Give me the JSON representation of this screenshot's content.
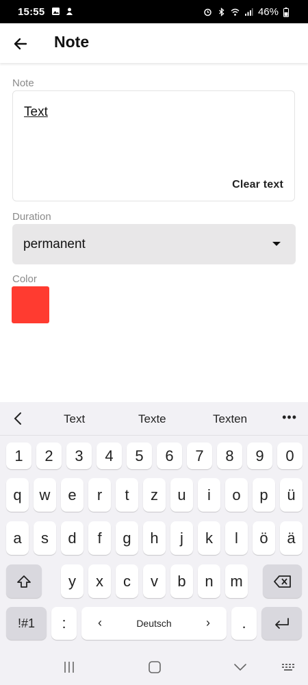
{
  "status": {
    "time": "15:55",
    "battery": "46%",
    "left_icons": [
      "image-icon",
      "notification-icon"
    ],
    "right_icons": [
      "alarm-icon",
      "bluetooth-icon",
      "wifi-icon",
      "signal-icon",
      "battery-icon"
    ]
  },
  "appbar": {
    "title": "Note"
  },
  "form": {
    "note_label": "Note",
    "note_value": "Text",
    "clear_label": "Clear text",
    "duration_label": "Duration",
    "duration_value": "permanent",
    "color_label": "Color",
    "color_value": "#ff3b30"
  },
  "keyboard": {
    "suggestions": [
      "Text",
      "Texte",
      "Texten"
    ],
    "more": "•••",
    "row_numbers": [
      "1",
      "2",
      "3",
      "4",
      "5",
      "6",
      "7",
      "8",
      "9",
      "0"
    ],
    "row1": [
      "q",
      "w",
      "e",
      "r",
      "t",
      "z",
      "u",
      "i",
      "o",
      "p",
      "ü"
    ],
    "row2": [
      "a",
      "s",
      "d",
      "f",
      "g",
      "h",
      "j",
      "k",
      "l",
      "ö",
      "ä"
    ],
    "row3": [
      "y",
      "x",
      "c",
      "v",
      "b",
      "n",
      "m"
    ],
    "symbols_label": "!#1",
    "colon_label": ":",
    "language_label": "Deutsch",
    "period_label": "."
  },
  "colors": {
    "accent": "#ff3b30",
    "keyboard_bg": "#f2f1f5",
    "select_bg": "#e8e7e8"
  }
}
